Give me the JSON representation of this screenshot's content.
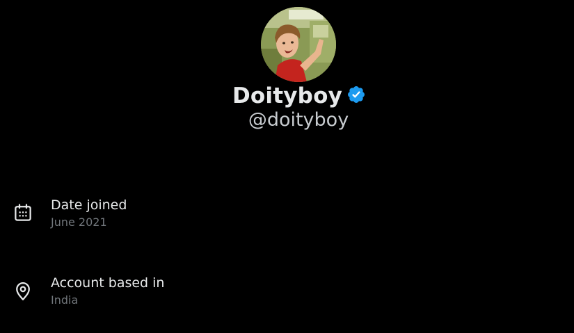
{
  "profile": {
    "display_name": "Doityboy",
    "handle": "@doityboy",
    "verified": true,
    "verified_color": "#1d9bf0",
    "avatar_icon": "profile-photo"
  },
  "details": [
    {
      "icon": "calendar-icon",
      "title": "Date joined",
      "value": "June 2021"
    },
    {
      "icon": "location-pin-icon",
      "title": "Account based in",
      "value": "India"
    }
  ]
}
